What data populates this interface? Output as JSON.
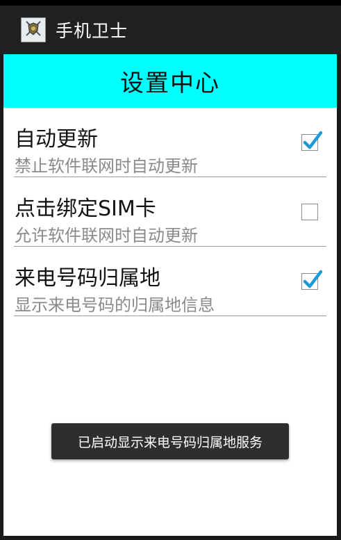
{
  "app_bar": {
    "title": "手机卫士",
    "icon": "shield-swords-icon"
  },
  "header": {
    "title": "设置中心",
    "background": "#00ffff"
  },
  "preferences": [
    {
      "title": "自动更新",
      "summary": "禁止软件联网时自动更新",
      "checked": true
    },
    {
      "title": "点击绑定SIM卡",
      "summary": "允许软件联网时自动更新",
      "checked": false
    },
    {
      "title": "来电号码归属地",
      "summary": "显示来电号码的归属地信息",
      "checked": true
    }
  ],
  "toast": {
    "text": "已启动显示来电号码归属地服务"
  },
  "colors": {
    "check_mark": "#1e9bd7",
    "action_bar": "#212121"
  }
}
